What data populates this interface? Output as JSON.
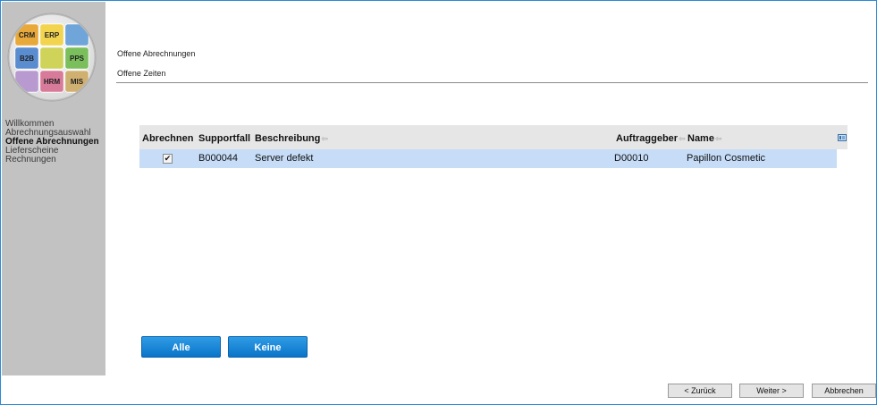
{
  "logo": {
    "pieces": [
      {
        "label": "CRM",
        "color": "#e8a93a"
      },
      {
        "label": "ERP",
        "color": "#f2d44e"
      },
      {
        "label": "",
        "color": "#6fa5d8"
      },
      {
        "label": "B2B",
        "color": "#5a8cd0"
      },
      {
        "label": "",
        "color": "#cfd35a"
      },
      {
        "label": "PPS",
        "color": "#7bbf5c"
      },
      {
        "label": "",
        "color": "#b89ad0"
      },
      {
        "label": "HRM",
        "color": "#d87a9a"
      },
      {
        "label": "MIS",
        "color": "#d0b070"
      }
    ]
  },
  "sidebar": {
    "items": [
      {
        "label": "Willkommen",
        "active": false
      },
      {
        "label": "Abrechnungsauswahl",
        "active": false
      },
      {
        "label": "Offene Abrechnungen",
        "active": true
      },
      {
        "label": "Lieferscheine",
        "active": false
      },
      {
        "label": "Rechnungen",
        "active": false
      }
    ]
  },
  "header": {
    "link1": "Offene Abrechnungen",
    "link2": "Offene Zeiten"
  },
  "table": {
    "columns": {
      "abrechnen": "Abrechnen",
      "supportfall": "Supportfall",
      "beschreibung": "Beschreibung",
      "auftraggeber": "Auftraggeber",
      "name": "Name"
    },
    "rows": [
      {
        "checked": "✔",
        "supportfall": "B000044",
        "beschreibung": "Server defekt",
        "auftraggeber": "D00010",
        "name": "Papillon Cosmetic"
      }
    ]
  },
  "buttons": {
    "alle": "Alle",
    "keine": "Keine",
    "back": "< Zurück",
    "next": "Weiter >",
    "cancel": "Abbrechen"
  },
  "colors": {
    "accent": "#1282d3",
    "row_selected": "#c6dcf7",
    "sidebar": "#c2c2c2"
  }
}
